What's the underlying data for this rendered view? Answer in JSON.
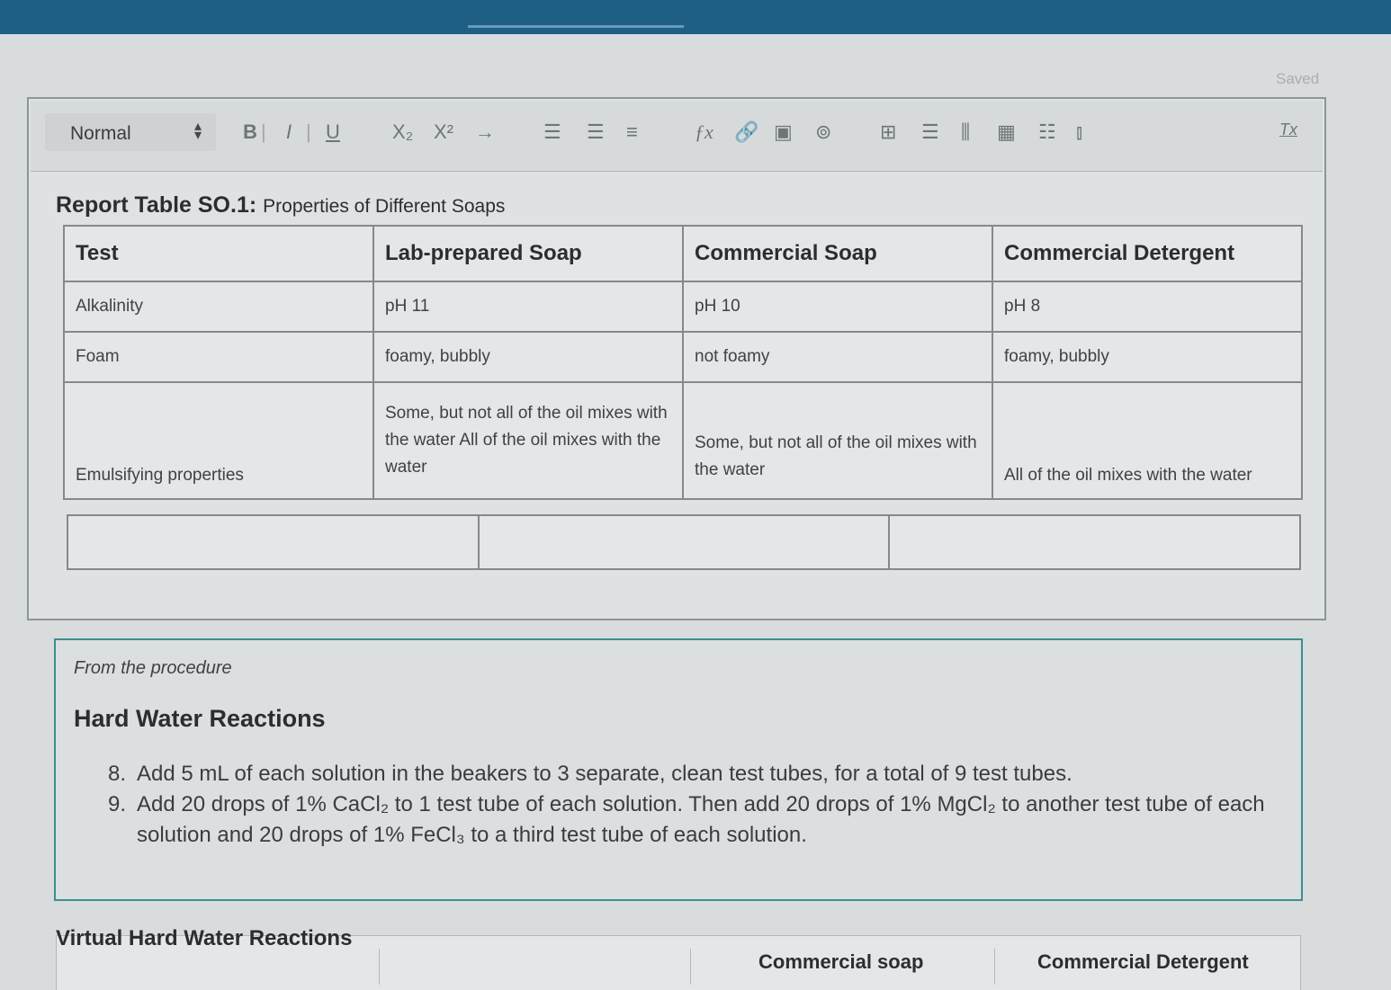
{
  "status": {
    "saved": "Saved"
  },
  "toolbar": {
    "format_value": "Normal",
    "bold": "B",
    "italic": "I",
    "underline": "U",
    "subscript": "X₂",
    "superscript": "X²",
    "clear_format": "Tx"
  },
  "report": {
    "caption_bold": "Report Table SO.1:",
    "caption_text": "Properties of Different Soaps",
    "headers": [
      "Test",
      "Lab-prepared Soap",
      "Commercial Soap",
      "Commercial Detergent"
    ],
    "rows": [
      [
        "Alkalinity",
        "pH 11",
        "pH 10",
        "pH 8"
      ],
      [
        "Foam",
        "foamy, bubbly",
        "not foamy",
        "foamy, bubbly"
      ],
      [
        "Emulsifying properties",
        "Some, but not all of the oil mixes with the water All of the oil mixes with the water",
        "Some, but not all of the oil mixes with the water",
        "All of the oil mixes with the water"
      ]
    ]
  },
  "procedure": {
    "label": "From the procedure",
    "title": "Hard Water Reactions",
    "steps": [
      {
        "num": "8.",
        "text": "Add 5 mL of each solution in the beakers to 3 separate, clean test tubes, for a total of 9 test tubes."
      },
      {
        "num": "9.",
        "text": "Add 20 drops of 1% CaCl₂ to 1 test tube of each solution. Then add 20 drops of 1% MgCl₂ to another test tube of each solution and 20 drops of 1% FeCl₃ to a third test tube of each solution."
      }
    ]
  },
  "virtual": {
    "title": "Virtual Hard Water Reactions",
    "headers": [
      "Commercial soap",
      "Commercial Detergent"
    ]
  }
}
